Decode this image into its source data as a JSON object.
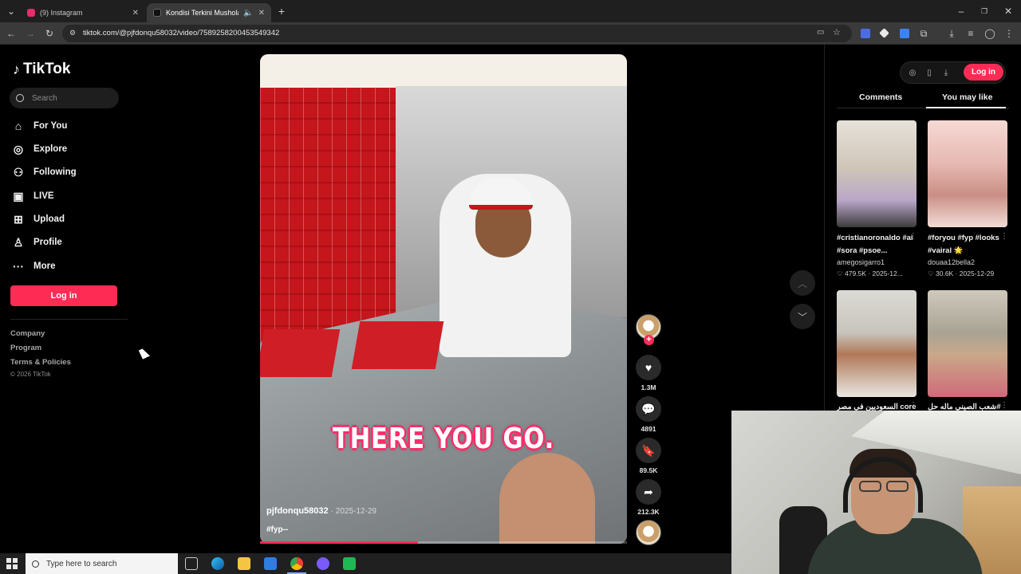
{
  "browser": {
    "tabs": [
      {
        "title": "(9) Instagram",
        "favicon_color": "#e1306c",
        "active": false
      },
      {
        "title": "Kondisi Terkini Musholas PI",
        "favicon_color": "#111111",
        "active": true
      }
    ],
    "url": "tiktok.com/@pjfdonqu58032/video/7589258200453549342"
  },
  "sidebar": {
    "brand": "TikTok",
    "search_placeholder": "Search",
    "nav": [
      {
        "label": "For You",
        "icon": "home-icon"
      },
      {
        "label": "Explore",
        "icon": "compass-icon"
      },
      {
        "label": "Following",
        "icon": "following-icon"
      },
      {
        "label": "LIVE",
        "icon": "live-icon"
      },
      {
        "label": "Upload",
        "icon": "upload-icon"
      },
      {
        "label": "Profile",
        "icon": "profile-icon"
      },
      {
        "label": "More",
        "icon": "more-icon"
      }
    ],
    "login_label": "Log in",
    "footer_links": [
      "Company",
      "Program",
      "Terms & Policies"
    ],
    "copyright": "© 2026 TikTok"
  },
  "video": {
    "caption_overlay": "THERE YOU GO.",
    "username": "pjfdonqu58032",
    "date": "2025-12-29",
    "description": "#fyp--",
    "progress": 0.43,
    "likes": "1.3M",
    "comments": "4891",
    "saves": "89.5K",
    "shares": "212.3K"
  },
  "right_panel": {
    "login_label": "Log in",
    "tabs": [
      "Comments",
      "You may like"
    ],
    "active_tab": "You may like",
    "cards": [
      {
        "title": "#cristianoronaldo #ai #sora #psoe...",
        "user": "amegosigarro1",
        "likes": "479.5K",
        "date": "2025-12..."
      },
      {
        "title": "#foryou #fyp #looks #vairal 🌟",
        "user": "douaa12bella2",
        "likes": "30.6K",
        "date": "2025-12-29"
      },
      {
        "title": "core السعوديين في مصر",
        "user": "",
        "likes": "",
        "date": ""
      },
      {
        "title": "#شعب الصيني ماله حل",
        "user": "",
        "likes": "",
        "date": ""
      }
    ]
  },
  "taskbar": {
    "search_placeholder": "Type here to search"
  },
  "colors": {
    "accent": "#fe2c55",
    "background": "#000000"
  }
}
